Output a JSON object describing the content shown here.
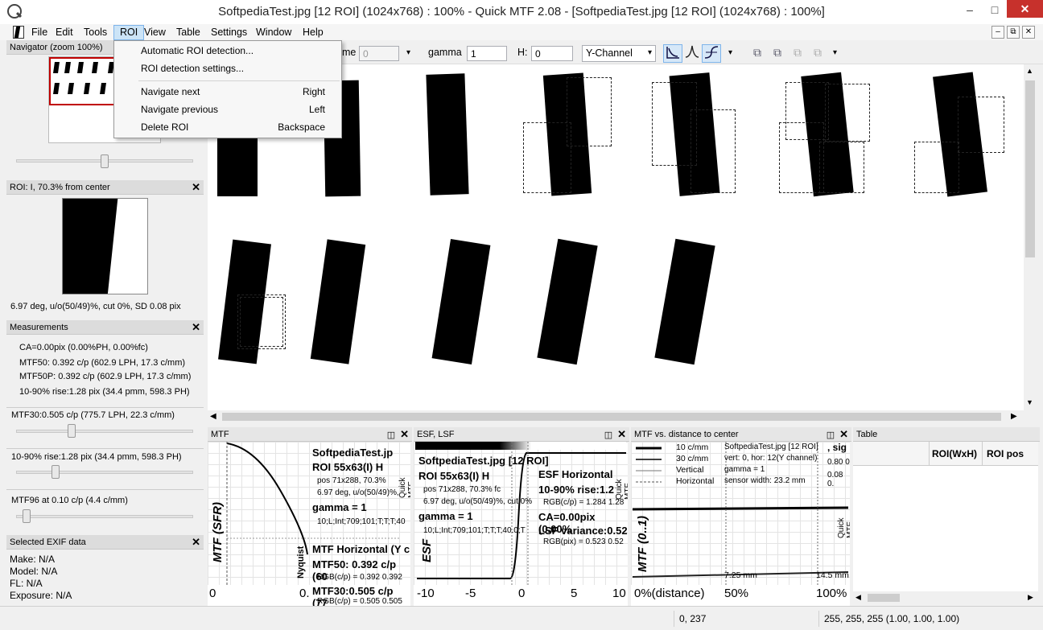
{
  "window": {
    "title": "SoftpediaTest.jpg [12 ROI] (1024x768) : 100% - Quick MTF 2.08 - [SoftpediaTest.jpg [12 ROI] (1024x768) : 100%]",
    "minimize": "–",
    "maximize": "□",
    "close": "✕"
  },
  "menu": {
    "items": [
      "File",
      "Edit",
      "Tools",
      "ROI",
      "View",
      "Table",
      "Settings",
      "Window",
      "Help"
    ],
    "mdi_min": "–",
    "mdi_restore": "⧉",
    "mdi_close": "✕"
  },
  "roi_menu": {
    "auto": "Automatic ROI detection...",
    "settings": "ROI detection settings...",
    "next": "Navigate next",
    "next_shortcut": "Right",
    "prev": "Navigate previous",
    "prev_shortcut": "Left",
    "delete": "Delete ROI",
    "delete_shortcut": "Backspace"
  },
  "toolbar": {
    "frame_label": "me",
    "frame_value": "0",
    "gamma_label": "gamma",
    "gamma_value": "1",
    "h_label": "H:",
    "h_value": "0",
    "channel": "Y-Channel",
    "more": "▾"
  },
  "navigator": {
    "title": "Navigator (zoom 100%)",
    "slider_value": 0.5
  },
  "roi_panel": {
    "title": "ROI: I, 70.3% from center",
    "info": "6.97 deg, u/o(50/49)%, cut 0%, SD 0.08 pix"
  },
  "measurements": {
    "title": "Measurements",
    "lines": [
      "CA=0.00pix (0.00%PH, 0.00%fc)",
      "MTF50: 0.392 c/p (602.9 LPH, 17.3 c/mm)",
      "MTF50P: 0.392 c/p (602.9 LPH, 17.3 c/mm)",
      "10-90% rise:1.28 pix (34.4 pmm, 598.3 PH)"
    ],
    "mtf30": "MTF30:0.505 c/p (775.7 LPH, 22.3 c/mm)",
    "rise": "10-90% rise:1.28 pix (34.4 pmm, 598.3 PH)",
    "mtf96": "MTF96 at 0.10 c/p (4.4 c/mm)"
  },
  "exif": {
    "title": "Selected EXIF data",
    "make": "Make: N/A",
    "model": "Model: N/A",
    "fl": "FL: N/A",
    "exposure": "Exposure: N/A"
  },
  "mtf_panel": {
    "title": "MTF",
    "file": "SoftpediaTest.jp",
    "roi": "ROI 55x63(I) H",
    "pos": "pos 71x288, 70.3%",
    "deg": "6.97 deg, u/o(50/49)%,",
    "gamma": "gamma = 1",
    "params": "10;L;Int;709;101;T;T;T;40",
    "orientation": "MTF Horizontal (Y c",
    "mtf50": "MTF50: 0.392 c/p (60",
    "rgb50": "RGB(c/p) = 0.392 0.392",
    "mtf30": "MTF30:0.505 c/p (77",
    "rgb30": "RGB(c/p) = 0.505 0.505",
    "ylabel": "MTF (SFR)",
    "nyquist": "Nyquist",
    "brand": "Quick MTF",
    "x0": "0",
    "x1": "0."
  },
  "esf_panel": {
    "title": "ESF, LSF",
    "file": "SoftpediaTest.jpg [12 ROI]",
    "roi": "ROI 55x63(I) H",
    "pos": "pos 71x288, 70.3% fc",
    "deg": "6.97 deg, u/o(50/49)%, cut 0%",
    "gamma": "gamma = 1",
    "params": "10;L;Int;709;101;T;T;T;40.0;T",
    "esf_h": "ESF Horizontal",
    "rise": "10-90% rise:1.2",
    "rgb_rise": "RGB(c/p) = 1.284 1.28",
    "ca": "CA=0.00pix (0.00%",
    "lsf": "LSF variance:0.52",
    "rgb_pix": "RGB(pix) = 0.523 0.52",
    "ylabel": "ESF",
    "brand": "Quick MTF",
    "ticks": [
      "-10",
      "-5",
      "0",
      "5",
      "10"
    ]
  },
  "dist_panel": {
    "title": "MTF vs. distance to center",
    "legend": [
      "10 c/mm",
      "30 c/mm",
      "Vertical",
      "Horizontal"
    ],
    "file": "SoftpediaTest.jpg [12 ROI]",
    "sig": ", sig",
    "vert": "vert: 0, hor: 12(Y channel)",
    "gamma": "gamma = 1",
    "sensor": "sensor width: 23.2 mm",
    "frag1": "0.80 0",
    "frag2": "0.08 0.",
    "ylabel": "MTF (0..1)",
    "brand": "Quick MTF",
    "mark1": "7.25 mm",
    "mark2": "14.5 mm",
    "x0": "0%(distance)",
    "x1": "50%",
    "x2": "100%"
  },
  "table_panel": {
    "title": "Table",
    "columns": [
      "ROI(WxH)",
      "ROI pos"
    ]
  },
  "status": {
    "coords": "0, 237",
    "color": "255, 255, 255 (1.00, 1.00, 1.00)"
  },
  "icons": {
    "close": "✕",
    "float": "◫"
  },
  "colors": {
    "menu_highlight": "#cce4f7",
    "nav_box": "#c00000",
    "close_btn": "#c7312c"
  }
}
